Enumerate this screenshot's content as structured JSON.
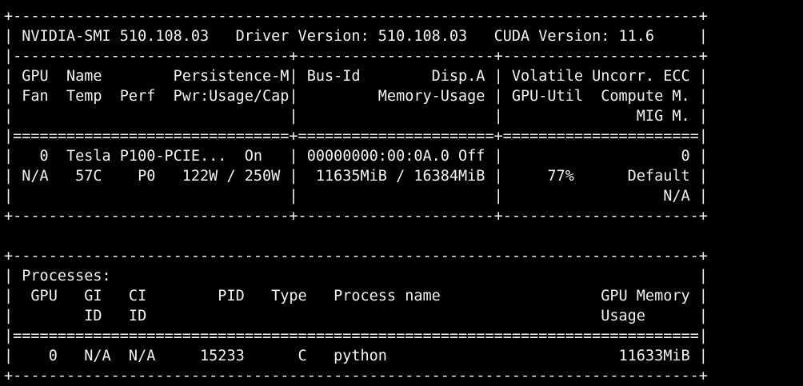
{
  "terminal": {
    "lines": [
      "+-----------------------------------------------------------------------------+",
      "+-----------------------------------------------------------------------------+",
      "| NVIDIA-SMI 510.108.03   Driver Version: 510.108.03   CUDA Version: 11.6     |",
      "|-------------------------------+----------------------+----------------------+",
      "| GPU  Name        Persistence-M| Bus-Id        Disp.A | Volatile Uncorr. ECC |",
      "| Fan  Temp  Perf  Pwr:Usage/Cap|         Memory-Usage | GPU-Util  Compute M. |",
      "|                               |                      |               MIG M. |",
      "|===============================+======================+======================|",
      "|   0  Tesla P100-PCIE...  On   | 00000000:00:0A.0 Off |                    0 |",
      "| N/A   57C    P0   122W / 250W |  11635MiB / 16384MiB |     77%      Default |",
      "|                               |                      |                  N/A |",
      "+-------------------------------+----------------------+----------------------+",
      "",
      "+-----------------------------------------------------------------------------+",
      "| Processes:                                                                  |",
      "|  GPU   GI   CI        PID   Type   Process name                  GPU Memory |",
      "|        ID   ID                                                   Usage      |",
      "|=============================================================================|",
      "|    0   N/A  N/A     15233      C   python                          11633MiB |",
      "+-----------------------------------------------------------------------------+"
    ]
  }
}
